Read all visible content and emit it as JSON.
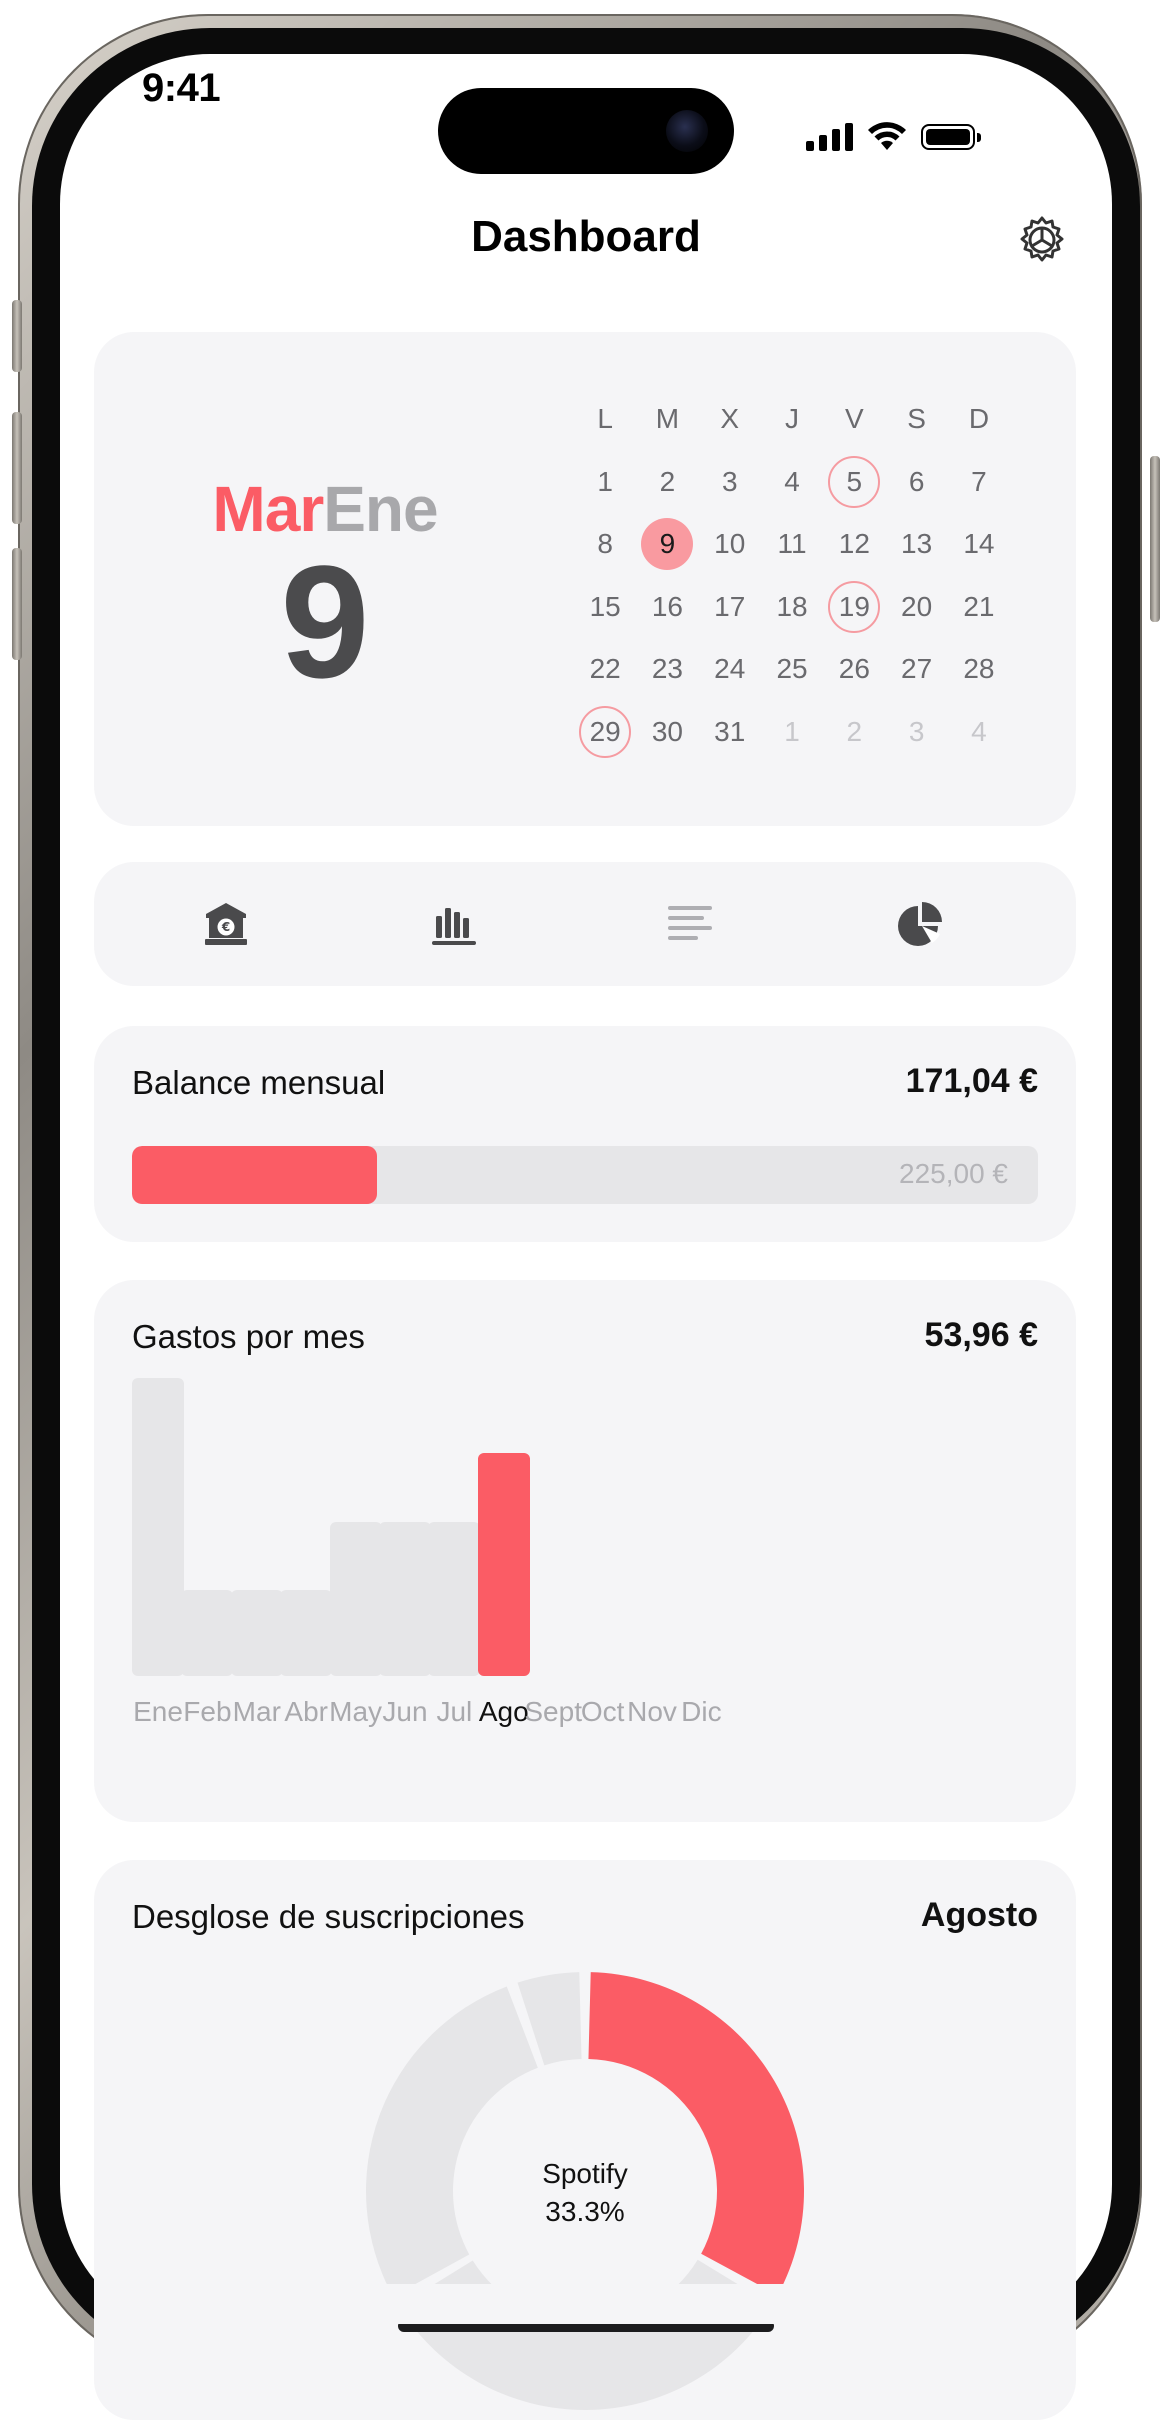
{
  "status_bar": {
    "time": "9:41"
  },
  "nav": {
    "title": "Dashboard"
  },
  "date_display": {
    "weekday": "Mar",
    "month": "Ene",
    "day": "9"
  },
  "calendar": {
    "weekdays": [
      "L",
      "M",
      "X",
      "J",
      "V",
      "S",
      "D"
    ],
    "days": [
      {
        "label": "1"
      },
      {
        "label": "2"
      },
      {
        "label": "3"
      },
      {
        "label": "4"
      },
      {
        "label": "5",
        "marked": true
      },
      {
        "label": "6"
      },
      {
        "label": "7"
      },
      {
        "label": "8"
      },
      {
        "label": "9",
        "today": true
      },
      {
        "label": "10"
      },
      {
        "label": "11"
      },
      {
        "label": "12"
      },
      {
        "label": "13"
      },
      {
        "label": "14"
      },
      {
        "label": "15"
      },
      {
        "label": "16"
      },
      {
        "label": "17"
      },
      {
        "label": "18"
      },
      {
        "label": "19",
        "marked": true
      },
      {
        "label": "20"
      },
      {
        "label": "21"
      },
      {
        "label": "22"
      },
      {
        "label": "23"
      },
      {
        "label": "24"
      },
      {
        "label": "25"
      },
      {
        "label": "26"
      },
      {
        "label": "27"
      },
      {
        "label": "28"
      },
      {
        "label": "29",
        "marked": true
      },
      {
        "label": "30"
      },
      {
        "label": "31"
      },
      {
        "label": "1",
        "dim": true
      },
      {
        "label": "2",
        "dim": true
      },
      {
        "label": "3",
        "dim": true
      },
      {
        "label": "4",
        "dim": true
      }
    ]
  },
  "tabs": [
    {
      "icon": "bank-euro-icon"
    },
    {
      "icon": "bar-chart-icon"
    },
    {
      "icon": "list-lines-icon"
    },
    {
      "icon": "pie-chart-icon"
    }
  ],
  "balance": {
    "title": "Balance mensual",
    "value": "171,04 €",
    "limit": "225,00 €",
    "progress_fraction": 0.27
  },
  "expenses": {
    "title": "Gastos por mes",
    "value": "53,96 €",
    "active_month": "Ago",
    "colors": {
      "active": "#fb5c65",
      "inactive": "#e6e6e8"
    }
  },
  "subscriptions": {
    "title": "Desglose de suscripciones",
    "period": "Agosto",
    "highlight_name": "Spotify",
    "highlight_pct": "33.3%"
  },
  "chart_data": [
    {
      "type": "bar",
      "categories": [
        "Ene",
        "Feb",
        "Mar",
        "Abr",
        "May",
        "Jun",
        "Jul",
        "Ago",
        "Sept",
        "Oct",
        "Nov",
        "Dic"
      ],
      "values": [
        71.9,
        20.9,
        20.9,
        20.9,
        37.1,
        37.1,
        37.1,
        53.96,
        0,
        0,
        0,
        0
      ],
      "highlighted_category": "Ago",
      "grid": false,
      "ylim": [
        0,
        72
      ]
    },
    {
      "type": "pie",
      "style": "donut",
      "slices": [
        {
          "label": "Spotify",
          "percent": 33.3,
          "color": "#fb5c65"
        },
        {
          "percent": 33.3,
          "color": "#e6e6e8"
        },
        {
          "percent": 28.0,
          "color": "#e6e6e8"
        },
        {
          "percent": 5.4,
          "color": "#e6e6e8"
        }
      ]
    }
  ],
  "colors": {
    "accent": "#fb5c65",
    "card_bg": "#f5f5f7",
    "track": "#e6e6e8"
  }
}
